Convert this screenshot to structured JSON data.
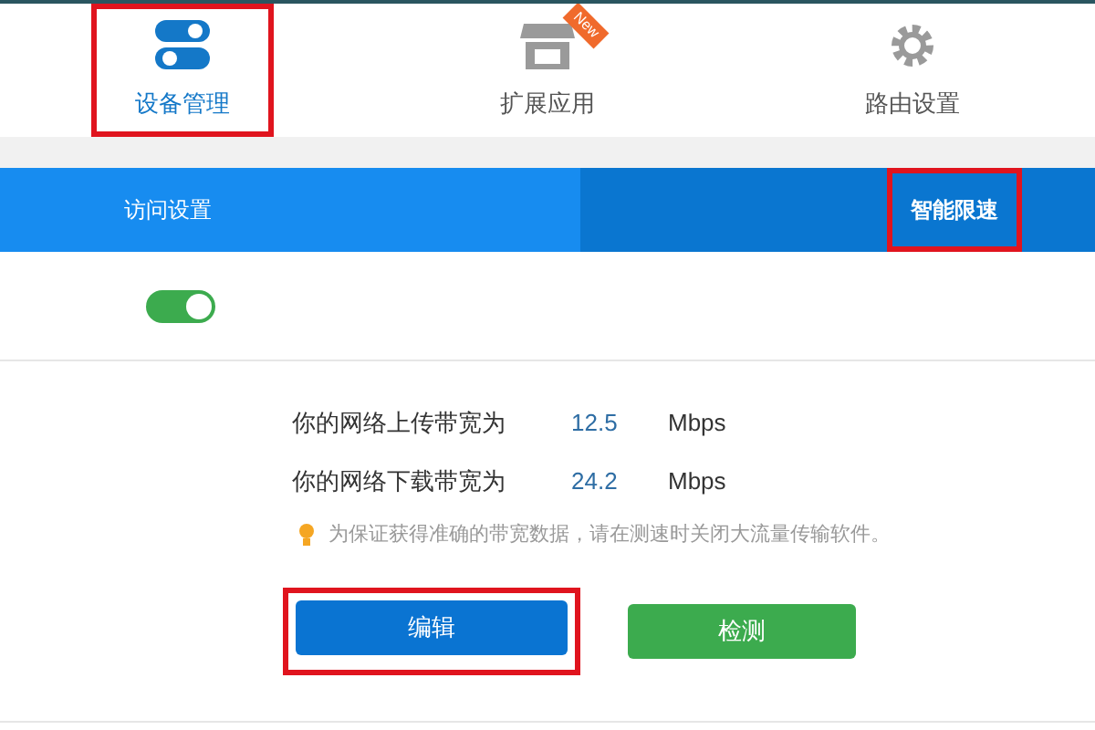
{
  "nav_tabs": [
    {
      "label": "设备管理",
      "selected": true,
      "highlighted": true
    },
    {
      "label": "扩展应用",
      "selected": false,
      "highlighted": false,
      "badge": "New"
    },
    {
      "label": "路由设置",
      "selected": false,
      "highlighted": false
    }
  ],
  "sub_tabs": [
    {
      "label": "访问设置",
      "selected": false,
      "highlighted": false
    },
    {
      "label": "智能限速",
      "selected": true,
      "highlighted": true
    }
  ],
  "speed_limit_switch": {
    "on": true
  },
  "bandwidth": [
    {
      "label": "你的网络上传带宽为",
      "value": "12.5",
      "unit": "Mbps"
    },
    {
      "label": "你的网络下载带宽为",
      "value": "24.2",
      "unit": "Mbps"
    }
  ],
  "tip": "为保证获得准确的带宽数据，请在测速时关闭大流量传输软件。",
  "buttons": [
    {
      "label": "编辑",
      "kind": "primary",
      "highlighted": true
    },
    {
      "label": "检测",
      "kind": "success",
      "highlighted": false
    }
  ]
}
